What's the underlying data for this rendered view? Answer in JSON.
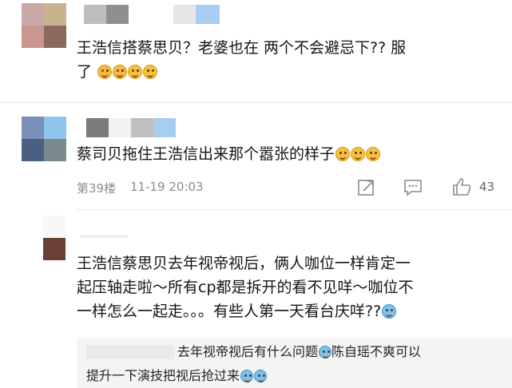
{
  "comments": [
    {
      "text_line1": "王浩信搭蔡思贝？老婆也在 两个不会避忌下?? 服",
      "text_line2": "了",
      "emoji": [
        "blush-face",
        "blush-face",
        "smile-face",
        "smile-face"
      ]
    },
    {
      "text_line1": "蔡司贝拖住王浩信出来那个嚣张的样子",
      "emoji": [
        "sweat-smile-face",
        "sweat-smile-face",
        "sweat-smile-face"
      ],
      "floor": "第39楼",
      "time": "11-19 20:03",
      "like_count": "43"
    },
    {
      "text_line1": "王浩信蔡思贝去年视帝视后，俩人咖位一样肯定一",
      "text_line2": "起压轴走啦～所有cp都是拆开的看不见咩～咖位不",
      "text_line3": "一样怎么一起走。。。有些人第一天看台庆咩??",
      "emoji": [
        "laugh-cry-face"
      ],
      "reply": {
        "line1": "去年视帝视后有什么问题",
        "line1b": "陈自瑶不爽可以",
        "line2": "提升一下演技把视后抢过来"
      }
    }
  ]
}
